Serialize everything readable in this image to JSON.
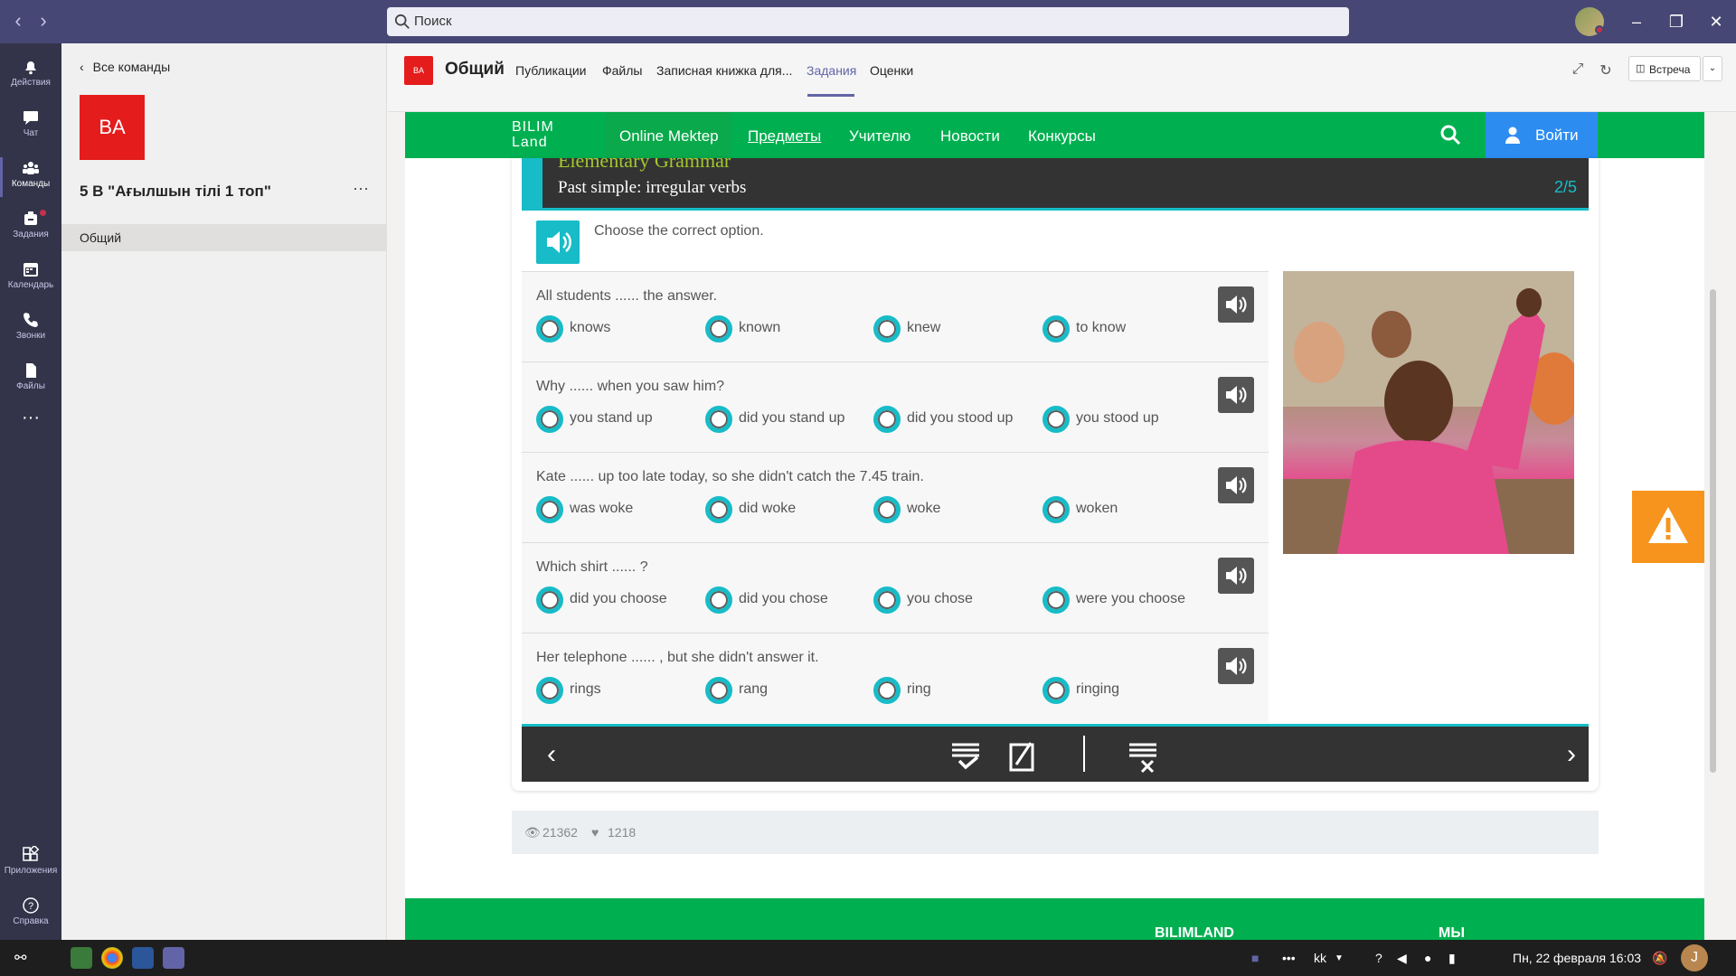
{
  "search": {
    "placeholder": "Поиск"
  },
  "rail": [
    {
      "label": "Действия",
      "icon": "bell-icon"
    },
    {
      "label": "Чат",
      "icon": "chat-icon"
    },
    {
      "label": "Команды",
      "icon": "teams-icon"
    },
    {
      "label": "Задания",
      "icon": "assignments-icon"
    },
    {
      "label": "Календарь",
      "icon": "calendar-icon"
    },
    {
      "label": "Звонки",
      "icon": "phone-icon"
    },
    {
      "label": "Файлы",
      "icon": "files-icon"
    },
    {
      "label": "Приложения",
      "icon": "apps-icon"
    },
    {
      "label": "Справка",
      "icon": "help-icon"
    }
  ],
  "sidebar": {
    "back_label": "Все команды",
    "team_initials": "BA",
    "team_name": "5 В \"Ағылшын тілі 1 топ\"",
    "channel": "Общий"
  },
  "header": {
    "channel_initials": "BA",
    "channel_title": "Общий",
    "tabs": [
      "Публикации",
      "Файлы",
      "Записная книжка для...",
      "Задания",
      "Оценки"
    ],
    "active_tab": "Задания",
    "meet_label": "Встреча"
  },
  "site": {
    "logo_line1": "BILIM",
    "logo_line2": "Land",
    "nav": [
      "Online Mektep",
      "Предметы",
      "Учителю",
      "Новости",
      "Конкурсы"
    ],
    "login": "Войти"
  },
  "lesson": {
    "category": "Elementary Grammar",
    "topic": "Past simple: irregular verbs",
    "page": "2/5",
    "instruction": "Choose the correct option.",
    "questions": [
      {
        "text": "All students ...... the answer.",
        "options": [
          "knows",
          "known",
          "knew",
          "to know"
        ]
      },
      {
        "text": "Why ...... when you saw him?",
        "options": [
          "you stand up",
          "did you stand up",
          "did you stood up",
          "you stood up"
        ]
      },
      {
        "text": "Kate ...... up too late today, so she didn't catch the 7.45 train.",
        "options": [
          "was woke",
          "did woke",
          "woke",
          "woken"
        ]
      },
      {
        "text": "Which shirt ...... ?",
        "options": [
          "did you choose",
          "did you chose",
          "you chose",
          "were you choose"
        ]
      },
      {
        "text": "Her telephone ...... , but she didn't answer it.",
        "options": [
          "rings",
          "rang",
          "ring",
          "ringing"
        ]
      }
    ]
  },
  "stats": {
    "views": "21362",
    "likes": "1218"
  },
  "footer": {
    "col1": "BILIMLAND",
    "col2": "МЫ"
  },
  "taskbar": {
    "lang": "kk",
    "datetime": "Пн, 22 февраля  16:03",
    "user": "J"
  },
  "colors": {
    "teams_purple": "#464775",
    "bilim_green": "#00b050",
    "accent_cyan": "#17bcc8",
    "team_red": "#e51c1c"
  }
}
